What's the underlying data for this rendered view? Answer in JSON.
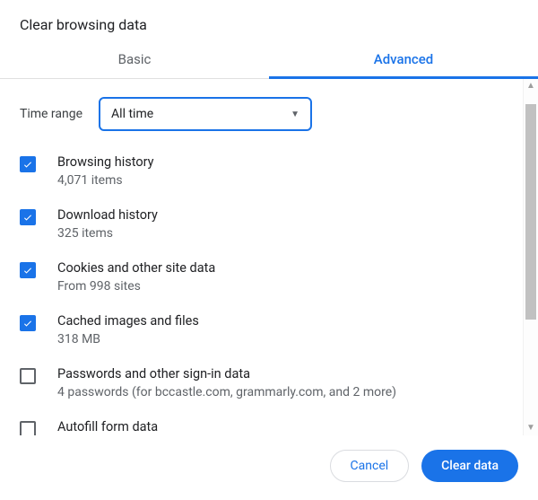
{
  "dialog": {
    "title": "Clear browsing data"
  },
  "tabs": {
    "basic": "Basic",
    "advanced": "Advanced"
  },
  "timeRange": {
    "label": "Time range",
    "value": "All time"
  },
  "items": [
    {
      "checked": true,
      "title": "Browsing history",
      "subtitle": "4,071 items"
    },
    {
      "checked": true,
      "title": "Download history",
      "subtitle": "325 items"
    },
    {
      "checked": true,
      "title": "Cookies and other site data",
      "subtitle": "From 998 sites"
    },
    {
      "checked": true,
      "title": "Cached images and files",
      "subtitle": "318 MB"
    },
    {
      "checked": false,
      "title": "Passwords and other sign-in data",
      "subtitle": "4 passwords (for bccastle.com, grammarly.com, and 2 more)"
    },
    {
      "checked": false,
      "title": "Autofill form data",
      "subtitle": ""
    }
  ],
  "footer": {
    "cancel": "Cancel",
    "clear": "Clear data"
  }
}
